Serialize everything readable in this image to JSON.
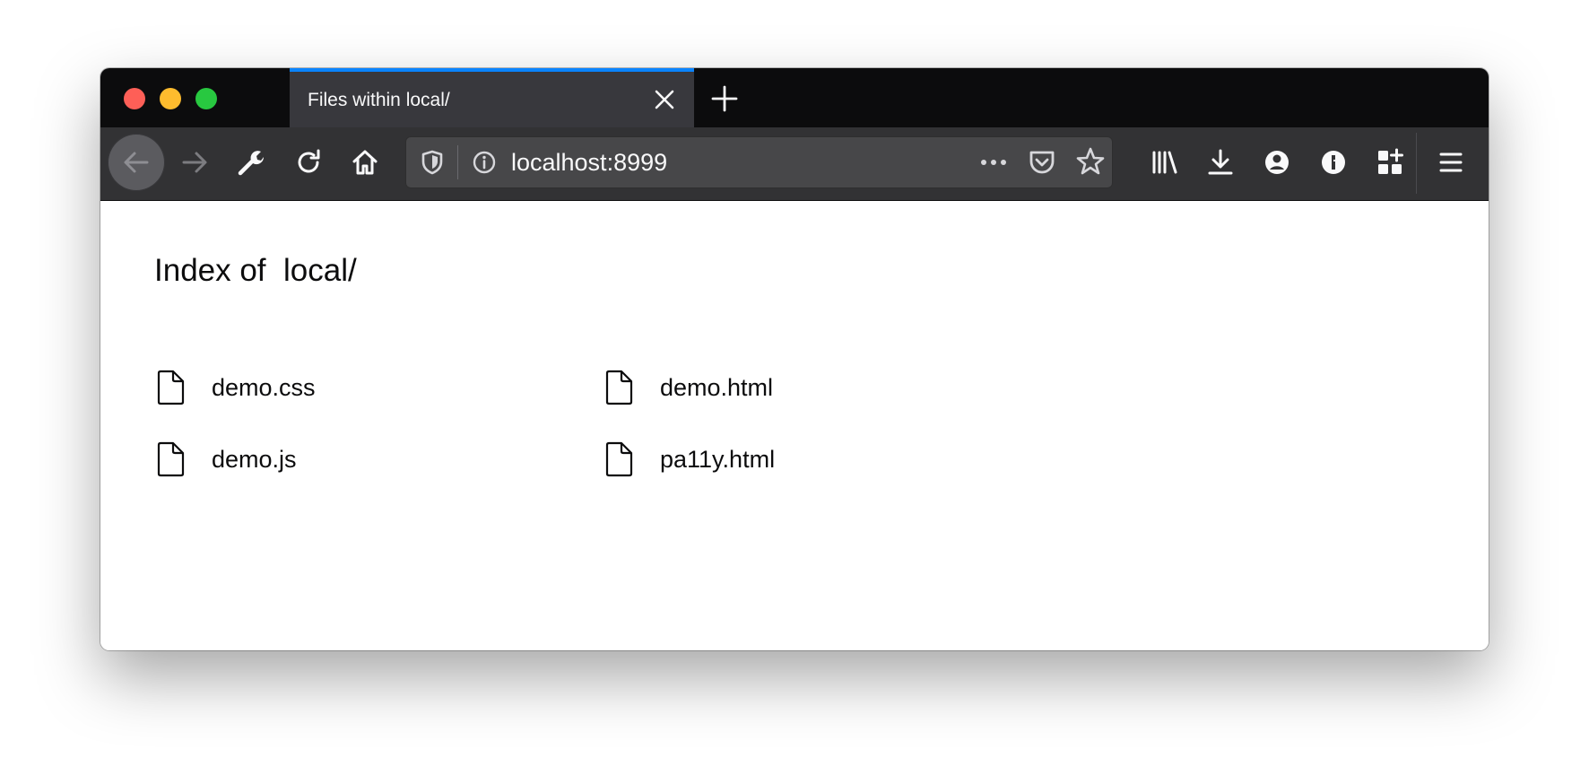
{
  "window": {
    "controls": [
      "close",
      "minimize",
      "zoom"
    ]
  },
  "tab": {
    "title": "Files within local/",
    "close_icon": "close-icon",
    "accent": "#0a84ff"
  },
  "new_tab_icon": "plus-icon",
  "toolbar": {
    "buttons": [
      "back-icon",
      "forward-icon",
      "wrench-icon",
      "reload-icon",
      "home-icon"
    ],
    "url": "localhost:8999",
    "url_icons": [
      "shield-icon",
      "info-icon",
      "more-icon",
      "pocket-icon",
      "star-icon"
    ],
    "right_icons": [
      "library-icon",
      "download-icon",
      "account-icon",
      "password-icon",
      "extensions-icon",
      "menu-icon"
    ]
  },
  "page": {
    "title": "Index of  local/",
    "files": [
      {
        "name": "demo.css",
        "icon": "file-icon"
      },
      {
        "name": "demo.html",
        "icon": "file-icon"
      },
      {
        "name": "demo.js",
        "icon": "file-icon"
      },
      {
        "name": "pa11y.html",
        "icon": "file-icon"
      }
    ]
  },
  "colors": {
    "tabstrip": "#0c0c0d",
    "active_tab": "#38383d",
    "toolbar": "#323234",
    "urlbar": "#474749",
    "page_bg": "#ffffff"
  }
}
